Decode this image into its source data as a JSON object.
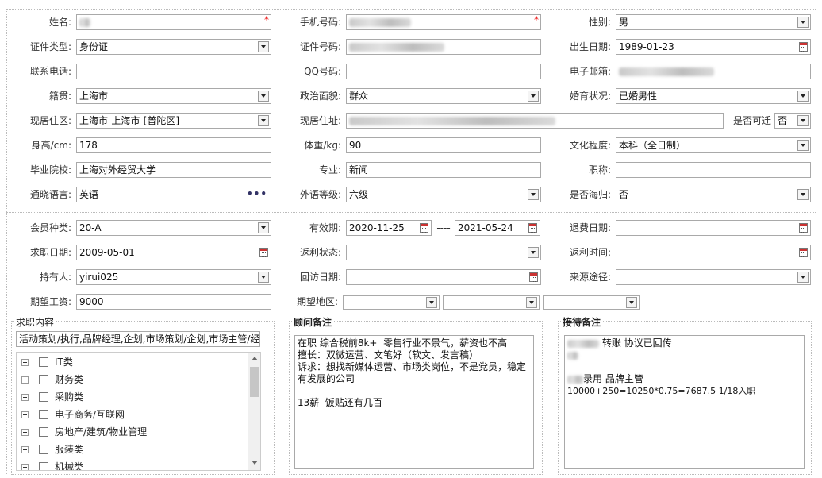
{
  "basic": {
    "name": {
      "label": "姓名:"
    },
    "phone": {
      "label": "手机号码:"
    },
    "gender": {
      "label": "性别:",
      "value": "男"
    },
    "id_type": {
      "label": "证件类型:",
      "value": "身份证"
    },
    "id_number": {
      "label": "证件号码:"
    },
    "birth_date": {
      "label": "出生日期:",
      "value": "1989-01-23"
    },
    "contact_phone": {
      "label": "联系电话:",
      "value": ""
    },
    "qq": {
      "label": "QQ号码:",
      "value": ""
    },
    "email": {
      "label": "电子邮箱:"
    },
    "native_place": {
      "label": "籍贯:",
      "value": "上海市"
    },
    "political_status": {
      "label": "政治面貌:",
      "value": "群众"
    },
    "marital_status": {
      "label": "婚育状况:",
      "value": "已婚男性"
    },
    "residence_area": {
      "label": "现居住区:",
      "value": "上海市-上海市-[普陀区]"
    },
    "address": {
      "label": "现居住址:"
    },
    "relocatable": {
      "label": "是否可迁",
      "value": "否"
    },
    "height": {
      "label": "身高/cm:",
      "value": "178"
    },
    "weight": {
      "label": "体重/kg:",
      "value": "90"
    },
    "education": {
      "label": "文化程度:",
      "value": "本科（全日制）"
    },
    "school": {
      "label": "毕业院校:",
      "value": "上海对外经贸大学"
    },
    "major": {
      "label": "专业:",
      "value": "新闻"
    },
    "title": {
      "label": "职称:",
      "value": ""
    },
    "language": {
      "label": "通晓语言:",
      "value": "英语",
      "more": "•••"
    },
    "language_level": {
      "label": "外语等级:",
      "value": "六级"
    },
    "overseas": {
      "label": "是否海归:",
      "value": "否"
    }
  },
  "membership": {
    "member_type": {
      "label": "会员种类:",
      "value": "20-A"
    },
    "valid_period": {
      "label": "有效期:",
      "start": "2020-11-25",
      "sep": "----",
      "end": "2021-05-24"
    },
    "refund_date": {
      "label": "退费日期:",
      "value": ""
    },
    "job_seek_date": {
      "label": "求职日期:",
      "value": "2009-05-01"
    },
    "rebate_status": {
      "label": "返利状态:",
      "value": ""
    },
    "rebate_time": {
      "label": "返利时间:",
      "value": ""
    },
    "holder": {
      "label": "持有人:",
      "value": "yirui025"
    },
    "callback_date": {
      "label": "回访日期:",
      "value": ""
    },
    "source": {
      "label": "来源途径:",
      "value": ""
    },
    "expected_salary": {
      "label": "期望工资:",
      "value": "9000"
    },
    "expected_region": {
      "label": "期望地区:"
    }
  },
  "job_content": {
    "title": "求职内容",
    "summary": "活动策划/执行,品牌经理,企划,市场策划/企划,市场主管/经理",
    "tree": [
      "IT类",
      "财务类",
      "采购类",
      "电子商务/互联网",
      "房地产/建筑/物业管理",
      "服装类",
      "机械类"
    ]
  },
  "advisor_notes": {
    "title": "顾问备注",
    "text": "在职 综合税前8k+  零售行业不景气，薪资也不高\n擅长：双微运营、文笔好（软文、发言稿）\n诉求：想找新媒体运营、市场类岗位，不是党员，稳定有发展的公司\n\n13薪  饭贴还有几百"
  },
  "reception_notes": {
    "title": "接待备注",
    "line1": "转账 协议已回传",
    "line3": "录用 品牌主管",
    "line4": "10000+250=10250*0.75=7687.5  1/18入职"
  },
  "required_mark": "*"
}
